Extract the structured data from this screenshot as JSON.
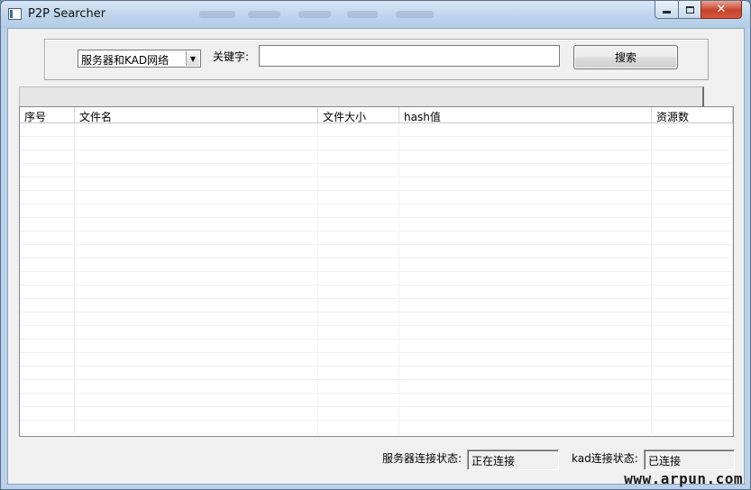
{
  "window": {
    "title": "P2P Searcher",
    "close_glyph": "✕",
    "background_color": "#b9d1ea"
  },
  "search": {
    "network_select_value": "服务器和KAD网络",
    "select_arrow": "▼",
    "keyword_label": "关键字:",
    "keyword_value": "",
    "search_button_label": "搜索"
  },
  "progress": {
    "value": 0
  },
  "results_table": {
    "columns": [
      "序号",
      "文件名",
      "文件大小",
      "hash值",
      "资源数"
    ],
    "rows": []
  },
  "status_bar": {
    "server_status_label": "服务器连接状态:",
    "server_status_value": "正在连接",
    "kad_status_label": "kad连接状态:",
    "kad_status_value": "已连接"
  },
  "watermark": "www.arpun.com"
}
